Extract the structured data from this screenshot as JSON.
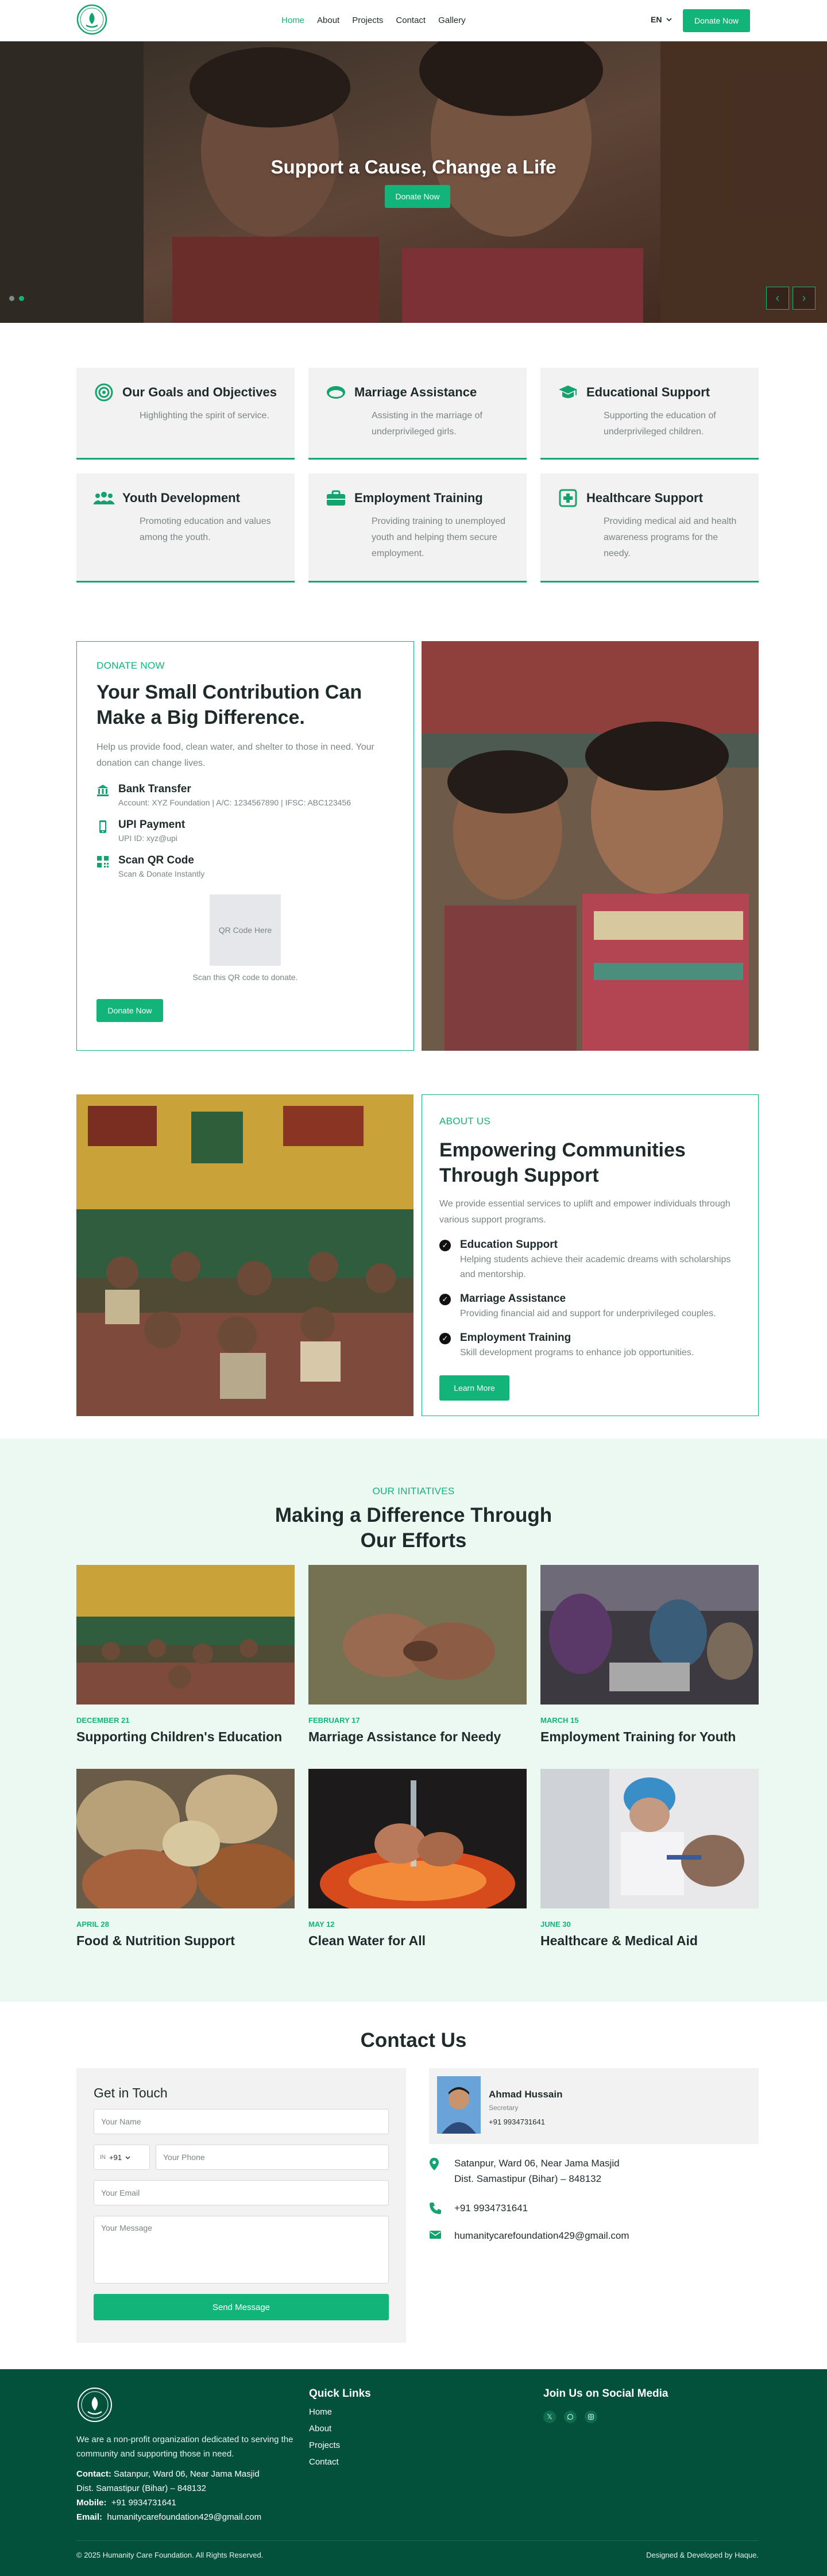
{
  "nav": {
    "links": [
      "Home",
      "About",
      "Projects",
      "Contact",
      "Gallery"
    ],
    "active": "Home",
    "language": "EN",
    "donate_label": "Donate Now"
  },
  "hero": {
    "title": "Support a Cause, Change a Life",
    "button": "Donate Now"
  },
  "goals": [
    {
      "title": "Our Goals and Objectives",
      "desc": "Highlighting the spirit of service.",
      "icon": "target-icon"
    },
    {
      "title": "Marriage Assistance",
      "desc": "Assisting in the marriage of underprivileged girls.",
      "icon": "ring-icon"
    },
    {
      "title": "Educational Support",
      "desc": "Supporting the education of underprivileged children.",
      "icon": "graduation-cap-icon"
    },
    {
      "title": "Youth Development",
      "desc": "Promoting education and values among the youth.",
      "icon": "users-icon"
    },
    {
      "title": "Employment Training",
      "desc": "Providing training to unemployed youth and helping them secure employment.",
      "icon": "briefcase-icon"
    },
    {
      "title": "Healthcare Support",
      "desc": "Providing medical aid and health awareness programs for the needy.",
      "icon": "medical-plus-icon"
    }
  ],
  "donate": {
    "eyebrow": "DONATE NOW",
    "title": "Your Small Contribution Can Make a Big Difference.",
    "desc": "Help us provide food, clean water, and shelter to those in need. Your donation can change lives.",
    "methods": [
      {
        "title": "Bank Transfer",
        "sub": "Account: XYZ Foundation | A/C: 1234567890 | IFSC: ABC123456",
        "icon": "bank-icon"
      },
      {
        "title": "UPI Payment",
        "sub": "UPI ID: xyz@upi",
        "icon": "mobile-icon"
      },
      {
        "title": "Scan QR Code",
        "sub": "Scan & Donate Instantly",
        "icon": "qr-icon"
      }
    ],
    "qr_placeholder": "QR Code Here",
    "qr_caption": "Scan this QR code to donate.",
    "button": "Donate Now"
  },
  "about": {
    "eyebrow": "ABOUT US",
    "title": "Empowering Communities Through Support",
    "desc": "We provide essential services to uplift and empower individuals through various support programs.",
    "features": [
      {
        "title": "Education Support",
        "desc": "Helping students achieve their academic dreams with scholarships and mentorship."
      },
      {
        "title": "Marriage Assistance",
        "desc": "Providing financial aid and support for underprivileged couples."
      },
      {
        "title": "Employment Training",
        "desc": "Skill development programs to enhance job opportunities."
      }
    ],
    "button": "Learn More"
  },
  "initiatives": {
    "eyebrow": "OUR INITIATIVES",
    "title": "Making a Difference Through Our Efforts",
    "items": [
      {
        "date": "DECEMBER 21",
        "title": "Supporting Children's Education"
      },
      {
        "date": "FEBRUARY 17",
        "title": "Marriage Assistance for Needy"
      },
      {
        "date": "MARCH 15",
        "title": "Employment Training for Youth"
      },
      {
        "date": "APRIL 28",
        "title": "Food & Nutrition Support"
      },
      {
        "date": "MAY 12",
        "title": "Clean Water for All"
      },
      {
        "date": "JUNE 30",
        "title": "Healthcare & Medical Aid"
      }
    ]
  },
  "contact": {
    "title": "Contact Us",
    "form_title": "Get in Touch",
    "name_placeholder": "Your Name",
    "country_code": "+91",
    "country_flag": "IN",
    "phone_placeholder": "Your Phone",
    "email_placeholder": "Your Email",
    "message_placeholder": "Your Message",
    "send_label": "Send Message",
    "person": {
      "name": "Ahmad Hussain",
      "role": "Secretary",
      "phone": "+91 9934731641"
    },
    "address_line1": "Satanpur, Ward 06, Near Jama Masjid",
    "address_line2": "Dist. Samastipur (Bihar) – 848132",
    "phone": "+91 9934731641",
    "email": "humanitycarefoundation429@gmail.com"
  },
  "footer": {
    "about": "We are a non-profit organization dedicated to serving the community and supporting those in need.",
    "contact_label": "Contact:",
    "address1": "Satanpur, Ward 06, Near Jama Masjid",
    "address2": "Dist. Samastipur (Bihar) – 848132",
    "mobile_label": "Mobile:",
    "mobile": "+91 9934731641",
    "email_label": "Email:",
    "email": "humanitycarefoundation429@gmail.com",
    "quick_links_title": "Quick Links",
    "quick_links": [
      "Home",
      "About",
      "Projects",
      "Contact"
    ],
    "social_title": "Join Us on Social Media",
    "social": [
      "x-icon",
      "whatsapp-icon",
      "instagram-icon"
    ],
    "copyright": "© 2025 Humanity Care Foundation. All Rights Reserved.",
    "developer": "Designed & Developed by Haque."
  },
  "colors": {
    "accent": "#12b47a",
    "footer": "#03513a",
    "initiatives_bg": "#ebf9f2"
  }
}
